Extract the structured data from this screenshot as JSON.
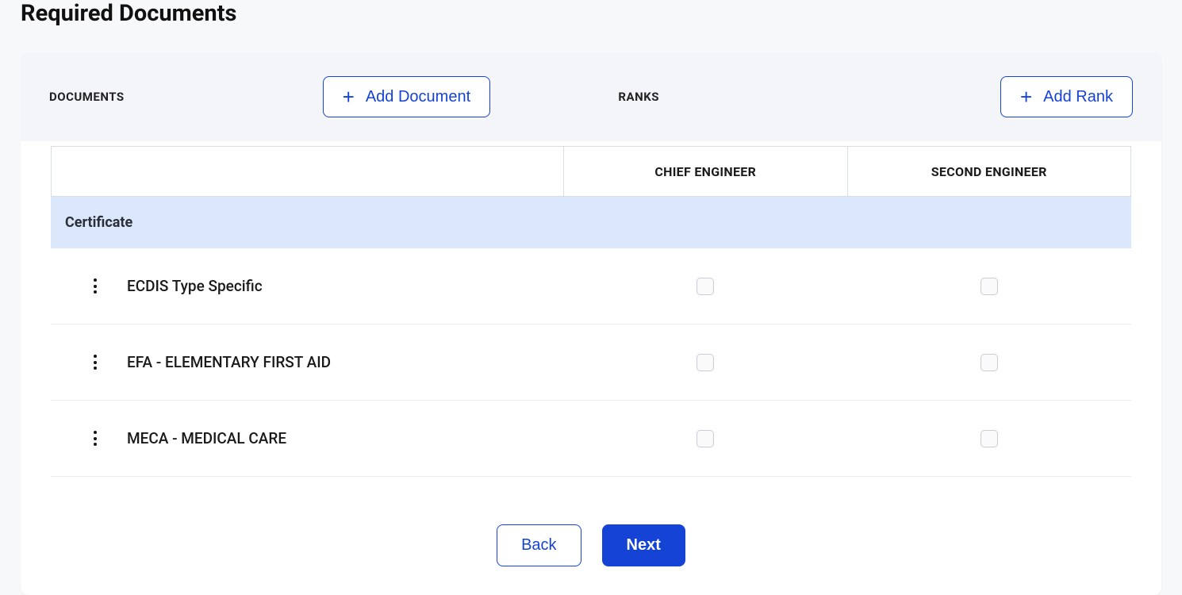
{
  "page": {
    "title": "Required Documents"
  },
  "toolbar": {
    "documents_label": "DOCUMENTS",
    "add_document_label": "Add Document",
    "ranks_label": "RANKS",
    "add_rank_label": "Add Rank"
  },
  "table": {
    "ranks": [
      "CHIEF ENGINEER",
      "SECOND ENGINEER"
    ],
    "section_label": "Certificate",
    "rows": [
      {
        "name": "ECDIS Type Specific"
      },
      {
        "name": "EFA - ELEMENTARY FIRST AID"
      },
      {
        "name": "MECA - MEDICAL CARE"
      }
    ]
  },
  "footer": {
    "back_label": "Back",
    "next_label": "Next"
  }
}
